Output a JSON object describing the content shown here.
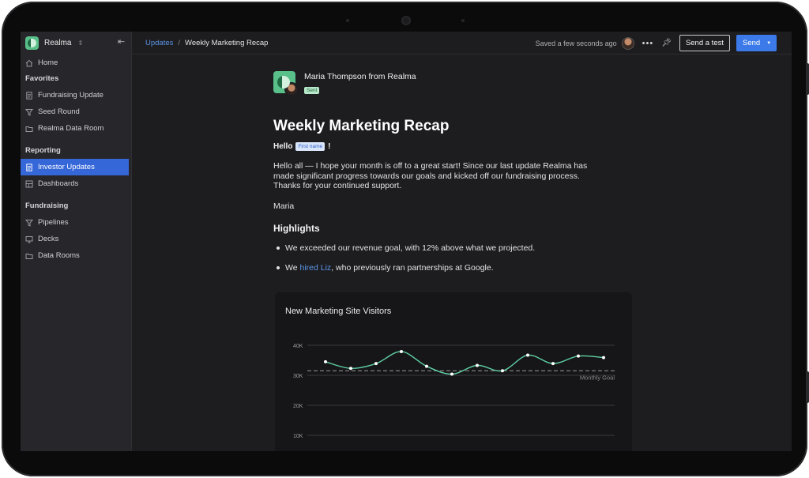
{
  "sidebar": {
    "workspace": "Realma",
    "home": "Home",
    "favorites_title": "Favorites",
    "favorites": [
      {
        "label": "Fundraising Update",
        "icon": "document-icon"
      },
      {
        "label": "Seed Round",
        "icon": "pipeline-icon"
      },
      {
        "label": "Realma Data Room",
        "icon": "folder-icon"
      }
    ],
    "reporting_title": "Reporting",
    "reporting": [
      {
        "label": "Investor Updates",
        "icon": "document-icon",
        "active": true
      },
      {
        "label": "Dashboards",
        "icon": "dashboard-icon"
      }
    ],
    "fundraising_title": "Fundraising",
    "fundraising": [
      {
        "label": "Pipelines",
        "icon": "pipeline-icon"
      },
      {
        "label": "Decks",
        "icon": "deck-icon"
      },
      {
        "label": "Data Rooms",
        "icon": "folder-icon"
      }
    ]
  },
  "topbar": {
    "breadcrumb_parent": "Updates",
    "breadcrumb_sep": "/",
    "breadcrumb_current": "Weekly Marketing Recap",
    "saved_status": "Saved a few seconds ago",
    "send_test_label": "Send a test",
    "send_label": "Send"
  },
  "email": {
    "sender": "Maria Thompson from Realma",
    "status_badge": "Sent",
    "title": "Weekly Marketing Recap",
    "greeting": "Hello",
    "merge_tag": "First name",
    "greeting_end": "!",
    "body": "Hello all — I hope your month is off to a great start! Since our last update Realma has made significant progress towards our goals and kicked off our fundraising process. Thanks for your continued support.",
    "signature": "Maria",
    "highlights_title": "Highlights",
    "bullet1": "We exceeded our revenue goal, with 12% above what we projected.",
    "bullet2_pre": "We ",
    "bullet2_link": "hired Liz",
    "bullet2_post": ", who previously ran partnerships at Google."
  },
  "colors": {
    "accent": "#3b7ae8",
    "line": "#5fd0a4",
    "goal": "#8a8a90"
  },
  "chart_data": {
    "type": "line",
    "title": "New Marketing Site Visitors",
    "y_ticks": [
      "40K",
      "30K",
      "20K",
      "10K"
    ],
    "ylim": [
      10000,
      40000
    ],
    "goal_label": "Monthly Goal",
    "goal_value": 31500,
    "x": [
      1,
      2,
      3,
      4,
      5,
      6,
      7,
      8,
      9,
      10,
      11,
      12
    ],
    "values": [
      34500,
      32300,
      33900,
      37900,
      33000,
      30400,
      33300,
      31500,
      36700,
      33900,
      36400,
      35900
    ],
    "grid": true
  }
}
